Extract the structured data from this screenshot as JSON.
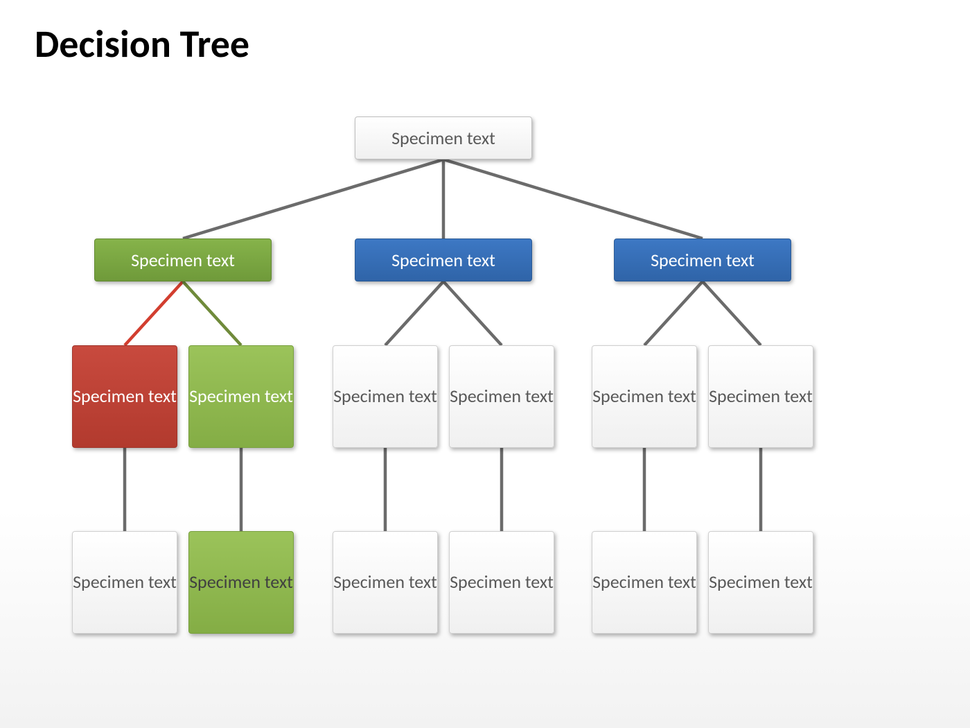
{
  "title": "Decision Tree",
  "root": {
    "label": "Specimen text"
  },
  "level1": [
    {
      "label": "Specimen text",
      "color": "green-dark"
    },
    {
      "label": "Specimen text",
      "color": "blue"
    },
    {
      "label": "Specimen text",
      "color": "blue"
    }
  ],
  "level2": [
    {
      "label": "Specimen text",
      "color": "red",
      "textcolor": "white"
    },
    {
      "label": "Specimen text",
      "color": "green",
      "textcolor": "white"
    },
    {
      "label": "Specimen text",
      "color": "white",
      "textcolor": "gray"
    },
    {
      "label": "Specimen text",
      "color": "white",
      "textcolor": "gray"
    },
    {
      "label": "Specimen text",
      "color": "white",
      "textcolor": "gray"
    },
    {
      "label": "Specimen text",
      "color": "white",
      "textcolor": "gray"
    }
  ],
  "level3": [
    {
      "label": "Specimen text",
      "color": "white",
      "textcolor": "gray"
    },
    {
      "label": "Specimen text",
      "color": "green-leaf",
      "textcolor": "gray"
    },
    {
      "label": "Specimen text",
      "color": "white",
      "textcolor": "gray"
    },
    {
      "label": "Specimen text",
      "color": "white",
      "textcolor": "gray"
    },
    {
      "label": "Specimen text",
      "color": "white",
      "textcolor": "gray"
    },
    {
      "label": "Specimen text",
      "color": "white",
      "textcolor": "gray"
    }
  ],
  "colors": {
    "connector_gray": "#6b6b6b",
    "connector_red": "#d23e2f",
    "connector_olive": "#6f8a3a"
  }
}
